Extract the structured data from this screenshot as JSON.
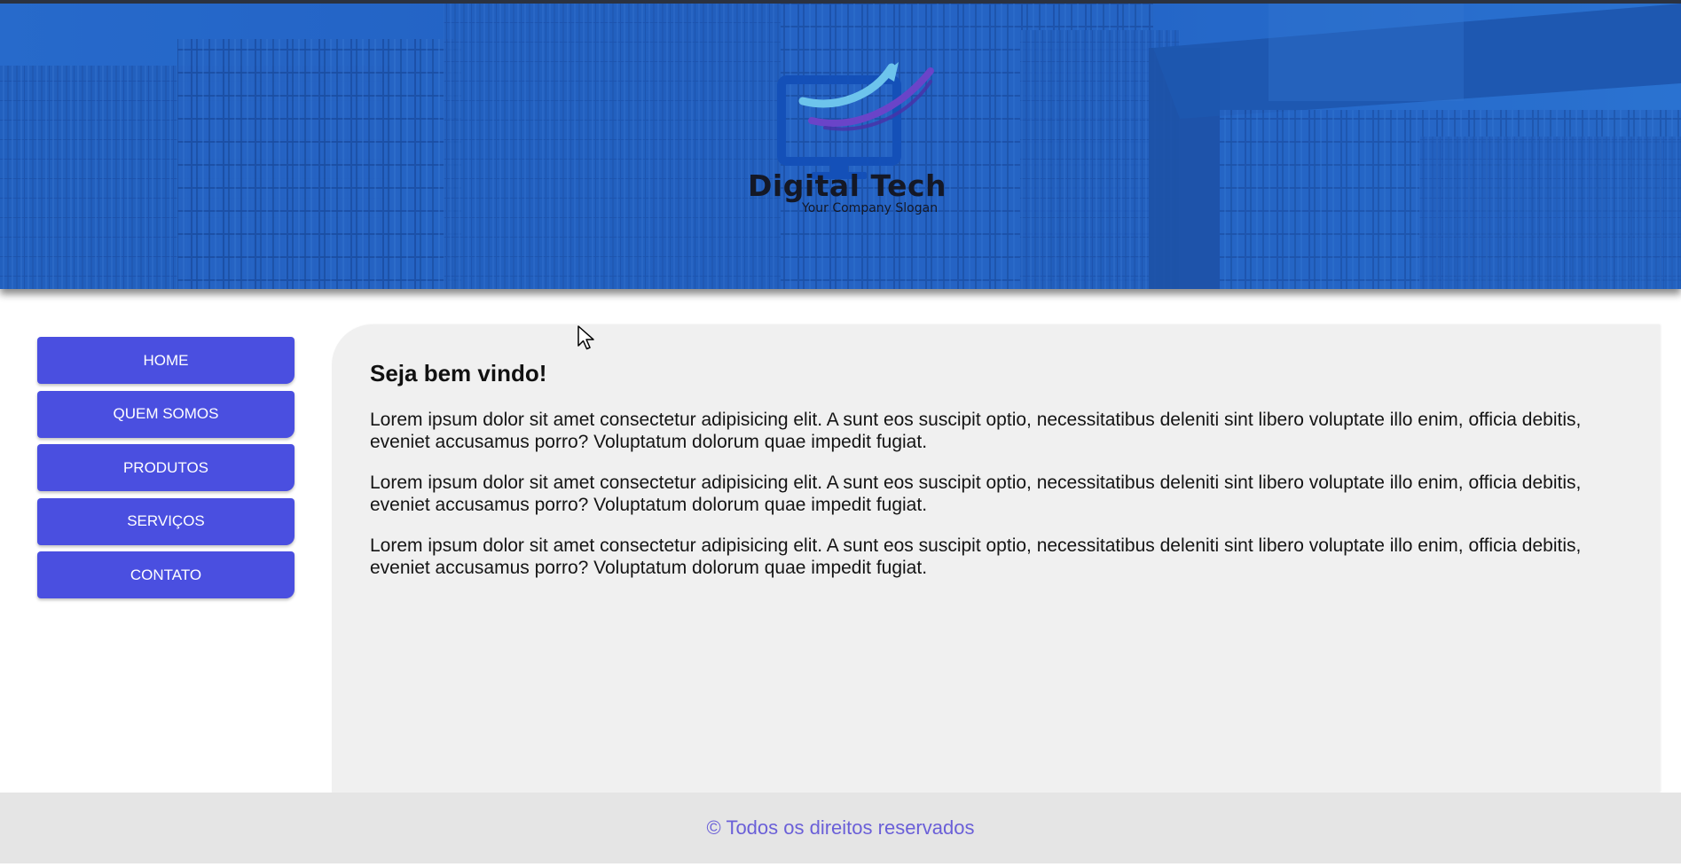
{
  "header": {
    "brand_title": "Digital Tech",
    "brand_slogan": "Your Company Slogan"
  },
  "nav": {
    "items": [
      {
        "label": "HOME"
      },
      {
        "label": "QUEM SOMOS"
      },
      {
        "label": "PRODUTOS"
      },
      {
        "label": "SERVIÇOS"
      },
      {
        "label": "CONTATO"
      }
    ]
  },
  "main": {
    "heading": "Seja bem vindo!",
    "paragraphs": [
      "Lorem ipsum dolor sit amet consectetur adipisicing elit. A sunt eos suscipit optio, necessitatibus deleniti sint libero voluptate illo enim, officia debitis, eveniet accusamus porro? Voluptatum dolorum quae impedit fugiat.",
      "Lorem ipsum dolor sit amet consectetur adipisicing elit. A sunt eos suscipit optio, necessitatibus deleniti sint libero voluptate illo enim, officia debitis, eveniet accusamus porro? Voluptatum dolorum quae impedit fugiat.",
      "Lorem ipsum dolor sit amet consectetur adipisicing elit. A sunt eos suscipit optio, necessitatibus deleniti sint libero voluptate illo enim, officia debitis, eveniet accusamus porro? Voluptatum dolorum quae impedit fugiat."
    ]
  },
  "footer": {
    "text": "© Todos os direitos reservados"
  },
  "colors": {
    "nav_button": "#4a4fe0",
    "banner_tint": "#1f5cc0",
    "footer_text": "#6a5fd8",
    "content_bg": "#f0f0f0",
    "footer_bg": "#e5e5e5"
  },
  "icons": {
    "logo": "monitor-arrow-logo-icon",
    "cursor": "mouse-pointer-icon"
  }
}
